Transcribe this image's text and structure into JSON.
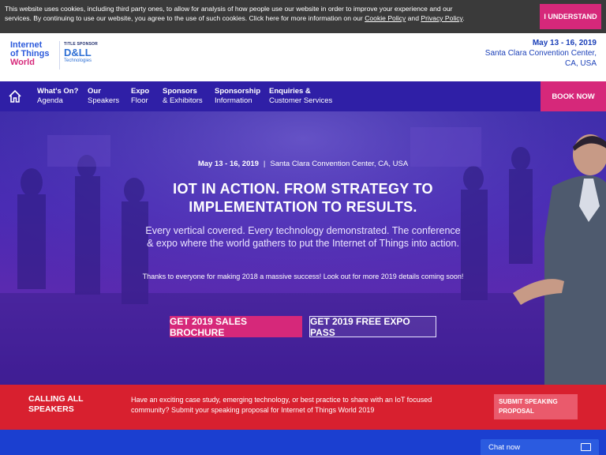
{
  "cookie": {
    "text_before": "This website uses cookies, including third party ones, to allow for analysis of how people use our website in order to improve your experience and our services. By continuing to use our website, you agree to the use of such cookies. Click here for more information on our ",
    "cookie_policy": "Cookie Policy",
    "and": " and ",
    "privacy_policy": "Privacy Policy",
    "period": ".",
    "button": "I UNDERSTAND"
  },
  "header": {
    "logo_line1": "Internet",
    "logo_line2": "of Things",
    "logo_line3": "World",
    "sponsor_label": "TITLE SPONSOR",
    "sponsor_brand": "D&LL",
    "sponsor_sub": "Technologies",
    "event_date": "May 13 - 16, 2019",
    "event_venue_line1": "Santa Clara Convention Center,",
    "event_venue_line2": "CA, USA"
  },
  "nav": {
    "home_icon": "home-icon",
    "items": [
      {
        "line1": "What's On?",
        "line2": "Agenda"
      },
      {
        "line1": "Our",
        "line2": "Speakers"
      },
      {
        "line1": "Expo",
        "line2": "Floor"
      },
      {
        "line1": "Sponsors",
        "line2": "& Exhibitors"
      },
      {
        "line1": "Sponsorship",
        "line2": "Information"
      },
      {
        "line1": "Enquiries &",
        "line2": "Customer Services"
      }
    ],
    "book_now": "BOOK NOW"
  },
  "hero": {
    "date": "May 13 - 16, 2019",
    "separator": "|",
    "venue": "Santa Clara Convention Center, CA, USA",
    "title": "IOT IN ACTION. FROM STRATEGY TO IMPLEMENTATION TO RESULTS.",
    "subtitle": "Every vertical covered. Every technology demonstrated. The conference & expo where the world gathers to put the Internet of Things into action.",
    "thanks": "Thanks to everyone for making 2018 a massive success! Look out for more 2019 details coming soon!",
    "btn_brochure": "GET 2019 SALES BROCHURE",
    "btn_expo": "GET 2019 FREE EXPO PASS"
  },
  "speakers": {
    "title": "CALLING ALL SPEAKERS",
    "text": "Have an exciting case study, emerging technology, or best practice to share with an IoT focused community? Submit your speaking proposal for Internet of Things World 2019",
    "button": "SUBMIT SPEAKING PROPOSAL"
  },
  "chat": {
    "label": "Chat now"
  },
  "colors": {
    "accent_pink": "#d6287a",
    "nav_purple": "#2f1fa6",
    "speakers_red": "#d8202f",
    "brand_blue": "#1a3fb8"
  }
}
